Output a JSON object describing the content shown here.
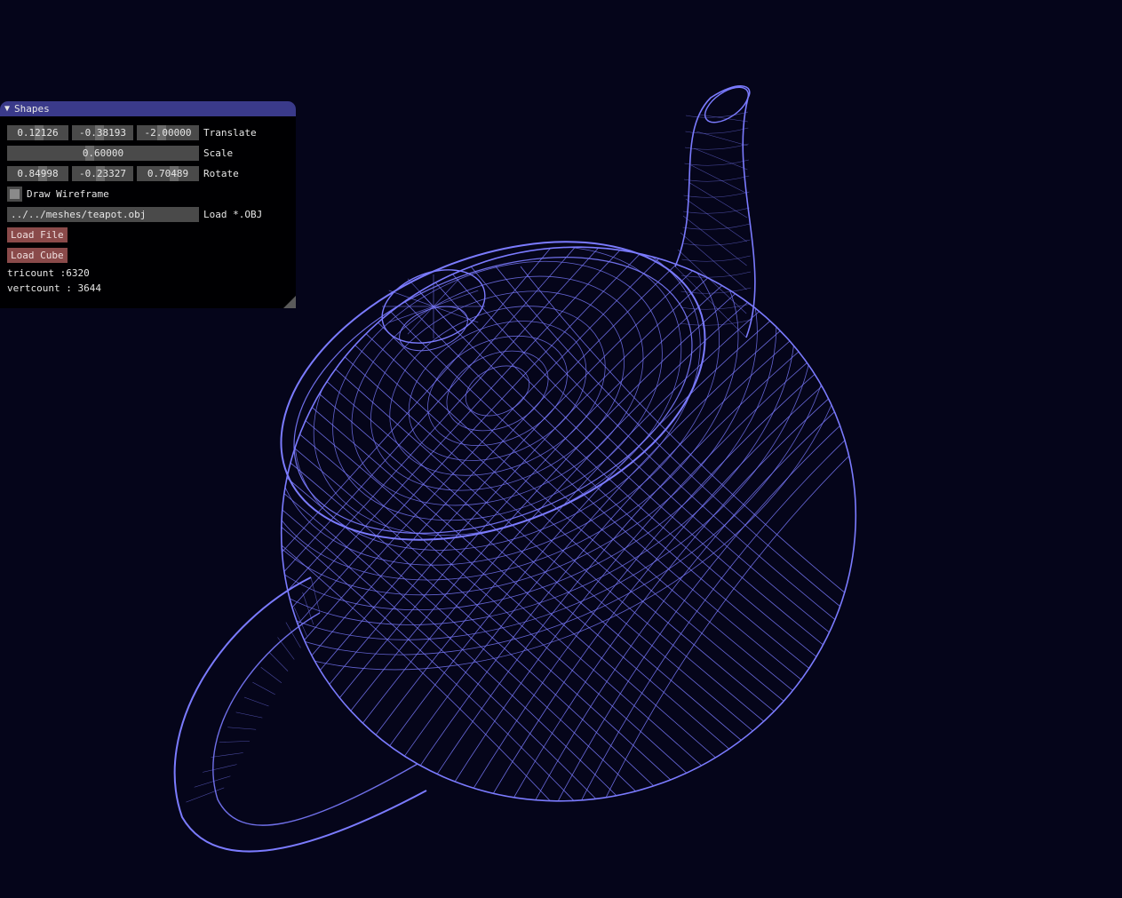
{
  "viewport": {
    "mesh_name": "teapot",
    "wire_color": "#7b7bff",
    "background": "#05051a"
  },
  "panel": {
    "title": "Shapes",
    "collapse_icon": "triangle-down-icon",
    "translate": {
      "label": "Translate",
      "x": "0.12126",
      "y": "-0.38193",
      "z": "-2.00000"
    },
    "scale": {
      "label": "Scale",
      "value": "0.60000"
    },
    "rotate": {
      "label": "Rotate",
      "x": "0.84998",
      "y": "-0.23327",
      "z": "0.70489"
    },
    "wireframe": {
      "label": "Draw Wireframe",
      "checked": false
    },
    "obj": {
      "path": "../../meshes/teapot.obj",
      "label": "Load *.OBJ"
    },
    "load_file_label": "Load File",
    "load_cube_label": "Load Cube",
    "tricount": "tricount :6320",
    "vertcount": "vertcount : 3644"
  }
}
